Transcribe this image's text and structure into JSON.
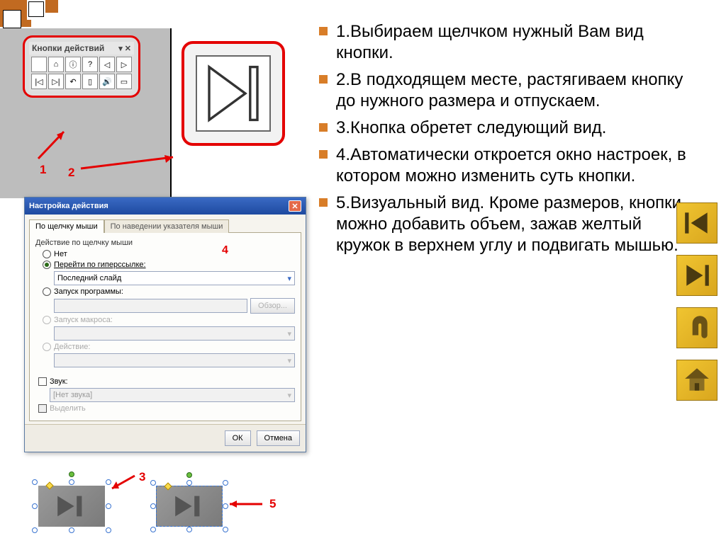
{
  "bullets": [
    "1.Выбираем щелчком нужный Вам вид кнопки.",
    "2.В подходящем месте, растягиваем кнопку до нужного размера и отпускаем.",
    "3.Кнопка обретет следующий вид.",
    "4.Автоматически откроется окно настроек, в котором можно изменить суть кнопки.",
    "5.Визуальный вид. Кроме размеров, кнопки можно добавить объем, зажав желтый кружок в верхнем углу и подвигать мышью."
  ],
  "annotations": {
    "one": "1",
    "two": "2",
    "three": "3",
    "four": "4",
    "five": "5"
  },
  "toolbar": {
    "title": "Кнопки действий"
  },
  "dialog": {
    "title": "Настройка действия",
    "tab1": "По щелчку мыши",
    "tab2": "По наведении указателя мыши",
    "group_label": "Действие по щелчку мыши",
    "opt_none": "Нет",
    "opt_hyperlink": "Перейти по гиперссылке:",
    "hyperlink_value": "Последний слайд",
    "opt_program": "Запуск программы:",
    "browse": "Обзор...",
    "opt_macro": "Запуск макроса:",
    "opt_action": "Действие:",
    "sound": "Звук:",
    "sound_value": "[Нет звука]",
    "highlight": "Выделить",
    "ok": "ОК",
    "cancel": "Отмена"
  }
}
